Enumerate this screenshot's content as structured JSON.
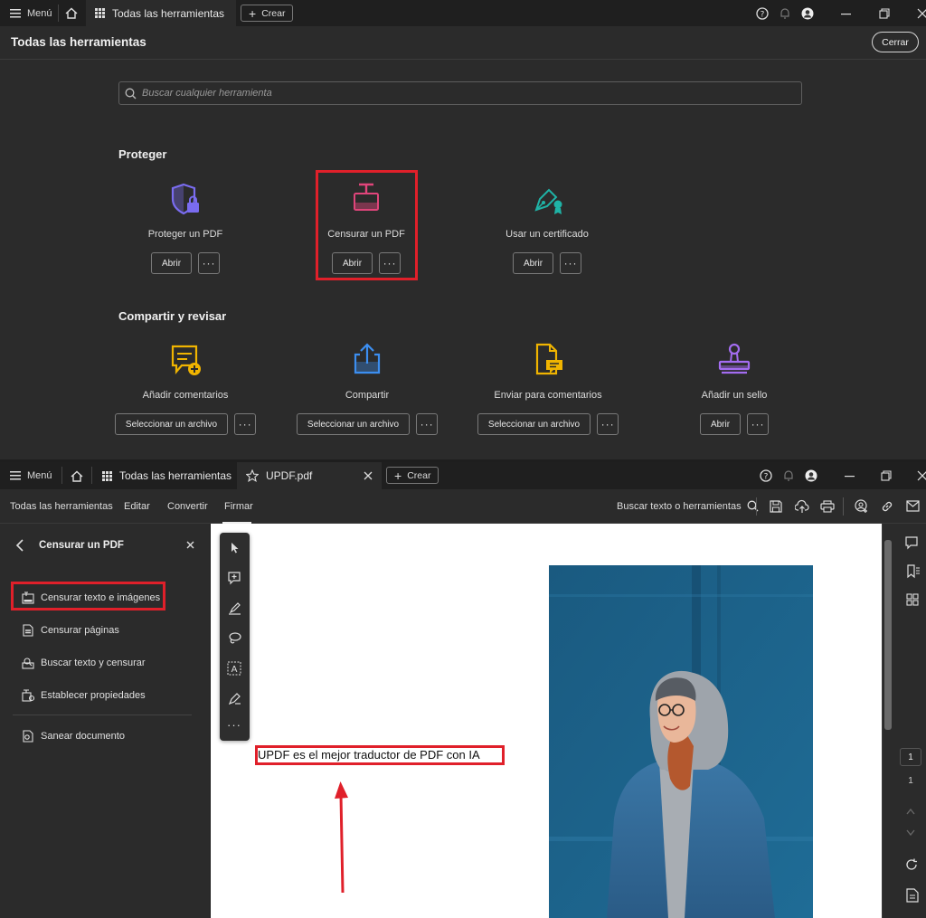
{
  "top_window": {
    "menu_label": "Menú",
    "tab_label": "Todas las herramientas",
    "create_label": "Crear",
    "page_title": "Todas las herramientas",
    "close_label": "Cerrar",
    "search_placeholder": "Buscar cualquier herramienta",
    "sections": [
      {
        "title": "Proteger",
        "tools": [
          {
            "name": "Proteger un PDF",
            "button": "Abrir",
            "icon": "shield-lock-icon",
            "color": "#7a6cf0"
          },
          {
            "name": "Censurar un PDF",
            "button": "Abrir",
            "icon": "redact-icon",
            "color": "#e0457b"
          },
          {
            "name": "Usar un certificado",
            "button": "Abrir",
            "icon": "certificate-pen-icon",
            "color": "#1fb3a6"
          }
        ]
      },
      {
        "title": "Compartir y revisar",
        "tools": [
          {
            "name": "Añadir comentarios",
            "button": "Seleccionar un archivo",
            "icon": "comment-add-icon",
            "color": "#f0b400"
          },
          {
            "name": "Compartir",
            "button": "Seleccionar un archivo",
            "icon": "share-icon",
            "color": "#3c8ef0"
          },
          {
            "name": "Enviar para comentarios",
            "button": "Seleccionar un archivo",
            "icon": "send-comments-icon",
            "color": "#f0b400"
          },
          {
            "name": "Añadir un sello",
            "button": "Abrir",
            "icon": "stamp-icon",
            "color": "#a36cf0"
          }
        ]
      }
    ]
  },
  "bottom_window": {
    "menu_label": "Menú",
    "tabs": [
      {
        "label": "Todas las herramientas"
      },
      {
        "label": "UPDF.pdf"
      }
    ],
    "create_label": "Crear",
    "menubar": [
      "Todas las herramientas",
      "Editar",
      "Convertir",
      "Firmar"
    ],
    "search_label": "Buscar texto o herramientas",
    "panel": {
      "title": "Censurar un PDF",
      "items": [
        "Censurar texto e imágenes",
        "Censurar páginas",
        "Buscar texto y censurar",
        "Establecer propiedades",
        "Sanear documento"
      ]
    },
    "document_text": "UPDF es el mejor traductor de PDF con IA",
    "page_current": "1",
    "page_total": "1"
  },
  "colors": {
    "highlight": "#e0202a",
    "bg_dark": "#1e1e1e",
    "bg_panel": "#2b2b2b"
  }
}
